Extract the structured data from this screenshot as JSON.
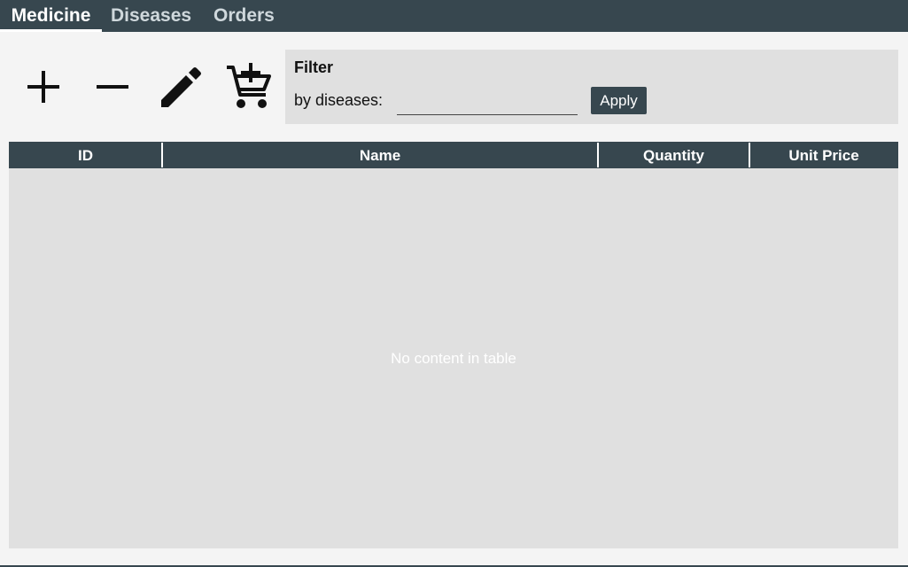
{
  "tabs": [
    {
      "label": "Medicine",
      "active": true
    },
    {
      "label": "Diseases",
      "active": false
    },
    {
      "label": "Orders",
      "active": false
    }
  ],
  "toolbar": {
    "buttons": [
      {
        "name": "add-button",
        "icon": "plus-icon"
      },
      {
        "name": "remove-button",
        "icon": "minus-icon"
      },
      {
        "name": "edit-button",
        "icon": "pencil-icon"
      },
      {
        "name": "add-to-cart-button",
        "icon": "cart-plus-icon"
      }
    ]
  },
  "filter": {
    "title": "Filter",
    "label": "by diseases:",
    "value": "",
    "placeholder": "",
    "apply_label": "Apply"
  },
  "table": {
    "columns": [
      "ID",
      "Name",
      "Quantity",
      "Unit Price"
    ],
    "rows": [],
    "empty_message": "No content in table"
  },
  "colors": {
    "header_bg": "#37474f",
    "panel_bg": "#e0e0e0",
    "page_bg": "#f4f4f4"
  }
}
